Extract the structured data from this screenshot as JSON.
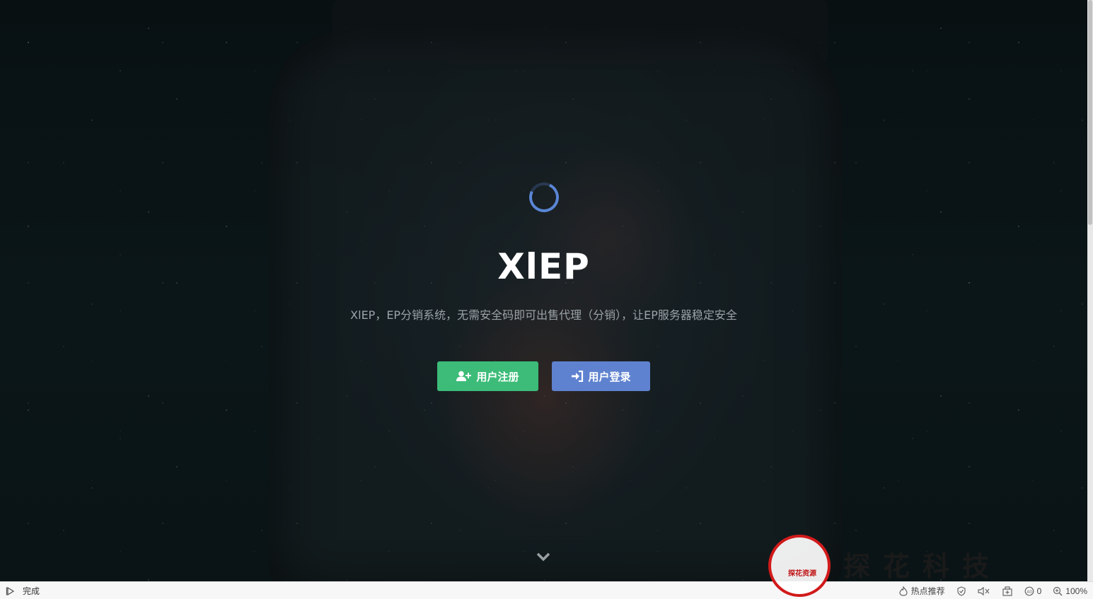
{
  "hero": {
    "title": "XlEP",
    "subtitle": "XlEP，EP分销系统，无需安全码即可出售代理（分销），让EP服务器稳定安全",
    "register_label": "用户注册",
    "login_label": "用户登录"
  },
  "colors": {
    "register_button": "#3cbc78",
    "login_button": "#5f82d0",
    "spinner": "#5a86d6",
    "watermark_red": "#d11a1a"
  },
  "statusbar": {
    "status_text": "完成",
    "hot_recommend": "热点推荐",
    "ad_block_count": "0",
    "zoom": "100%"
  },
  "watermark": {
    "brand": "探花科技",
    "seal_text": "探花资源"
  }
}
